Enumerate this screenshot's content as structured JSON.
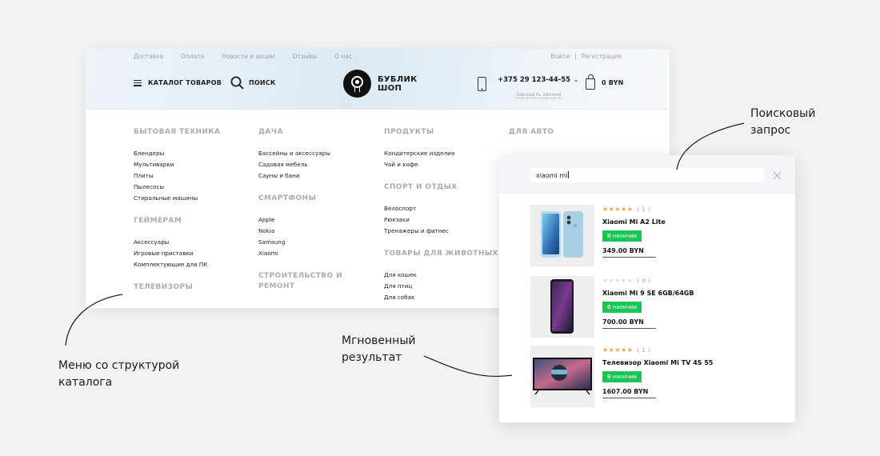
{
  "header": {
    "top_links": [
      "Доставка",
      "Оплата",
      "Новости и акции",
      "Отзывы",
      "О нас"
    ],
    "login": "Войти",
    "auth_separator": "|",
    "register": "Регистрация",
    "catalog_label": "КАТАЛОГ ТОВАРОВ",
    "search_label": "ПОИСК",
    "logo_line1": "БУБЛИК",
    "logo_line2": "ШОП",
    "phone": "+375 29 123-44-55",
    "phone_chevron": "⌄",
    "callback": "Заказать звонок",
    "cart_total": "0 BYN",
    "icons": {
      "menu": "burger-icon",
      "search": "search-icon",
      "phone": "phone-icon",
      "cart": "bag-icon"
    }
  },
  "menu": {
    "columns": [
      {
        "groups": [
          {
            "title": "БЫТОВАЯ ТЕХНИКА",
            "items": [
              "Блендеры",
              "Мультиварки",
              "Плиты",
              "Пылесосы",
              "Стиральные машины"
            ]
          },
          {
            "title": "ГЕЙМЕРАМ",
            "items": [
              "Аксессуары",
              "Игровые приставки",
              "Комплектующие для ПК"
            ]
          },
          {
            "title": "ТЕЛЕВИЗОРЫ",
            "items": []
          }
        ]
      },
      {
        "groups": [
          {
            "title": "ДАЧА",
            "items": [
              "Бассейны и аксессуары",
              "Садовая мебель",
              "Сауны и бани"
            ]
          },
          {
            "title": "СМАРТФОНЫ",
            "items": [
              "Apple",
              "Nokia",
              "Samsung",
              "Xiaomi"
            ]
          },
          {
            "title": "СТРОИТЕЛЬСТВО И РЕМОНТ",
            "items": []
          }
        ]
      },
      {
        "groups": [
          {
            "title": "ПРОДУКТЫ",
            "items": [
              "Кондитерские изделия",
              "Чай и кофе"
            ]
          },
          {
            "title": "СПОРТ И ОТДЫХ",
            "items": [
              "Велоспорт",
              "Рюкзаки",
              "Тренажеры и фитнес"
            ]
          },
          {
            "title": "ТОВАРЫ ДЛЯ ЖИВОТНЫХ",
            "items": [
              "Для кошек",
              "Для птиц",
              "Для собак"
            ]
          }
        ]
      },
      {
        "groups": [
          {
            "title": "ДЛЯ АВТО",
            "items": []
          }
        ]
      }
    ]
  },
  "search_popup": {
    "query": "xiaomi mi",
    "results": [
      {
        "name": "Xiaomi Mi A2 Lite",
        "rating": 5,
        "reviews": "( 1 )",
        "availability": "В наличии",
        "price": "349.00 BYN"
      },
      {
        "name": "Xiaomi Mi 9 SE 6GB/64GB",
        "rating": 0,
        "reviews": "( 0 )",
        "availability": "В наличии",
        "price": "700.00 BYN"
      },
      {
        "name": "Телевизор Xiaomi Mi TV 4S 55",
        "rating": 5,
        "reviews": "( 1 )",
        "availability": "В наличии",
        "price": "1607.00 BYN"
      }
    ]
  },
  "annotations": {
    "search_query": "Поисковый запрос",
    "instant_result": "Мгновенный результат",
    "menu_structure": "Меню со структурой каталога"
  },
  "colors": {
    "background": "#f1f2f4",
    "in_stock_green": "#17c653",
    "star_orange": "#f0a34a",
    "menu_heading_grey": "#a7adb4"
  }
}
